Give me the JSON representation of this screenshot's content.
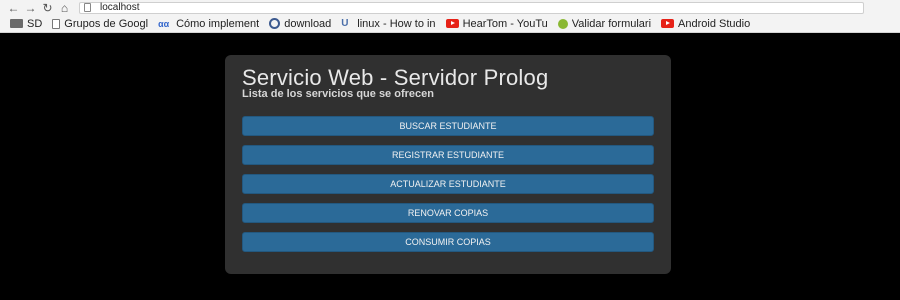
{
  "browser": {
    "url": "localhost",
    "bookmarks": [
      {
        "label": "SD",
        "icon": "folder-icon"
      },
      {
        "label": "Grupos de Googl",
        "icon": "page-icon"
      },
      {
        "label": "Cómo implement",
        "icon": "oa-site-icon"
      },
      {
        "label": "download",
        "icon": "site-icon"
      },
      {
        "label": "linux - How to in",
        "icon": "askubuntu-icon"
      },
      {
        "label": "HearTom - YouTu",
        "icon": "youtube-icon"
      },
      {
        "label": "Validar formulari",
        "icon": "green-dot-icon"
      },
      {
        "label": "Android Studio",
        "icon": "youtube-icon"
      }
    ]
  },
  "page": {
    "title": "Servicio Web - Servidor Prolog",
    "subtitle": "Lista de los servicios que se ofrecen",
    "buttons": [
      "BUSCAR ESTUDIANTE",
      "REGISTRAR ESTUDIANTE",
      "ACTUALIZAR ESTUDIANTE",
      "RENOVAR COPIAS",
      "CONSUMIR COPIAS"
    ],
    "button_color": "#2b6a98",
    "panel_color": "#303030"
  }
}
